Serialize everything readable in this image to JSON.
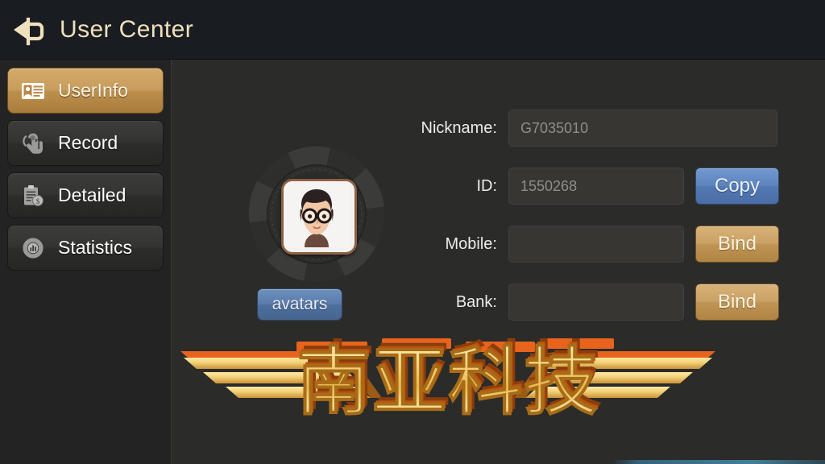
{
  "header": {
    "title": "User Center",
    "back_icon": "back-arrow-icon",
    "background_color": "#191c21",
    "title_color": "#f0e0bd"
  },
  "sidebar": {
    "background_color": "#232323",
    "active_color": "#c79c5c",
    "items": [
      {
        "id": "userinfo",
        "label": "UserInfo",
        "icon": "id-card-icon",
        "active": true
      },
      {
        "id": "record",
        "label": "Record",
        "icon": "hand-tap-icon",
        "active": false
      },
      {
        "id": "detailed",
        "label": "Detailed",
        "icon": "clipboard-money-icon",
        "active": false
      },
      {
        "id": "statistics",
        "label": "Statistics",
        "icon": "pie-chart-bars-icon",
        "active": false
      }
    ]
  },
  "main": {
    "avatar": {
      "image_alt": "cartoon-boy-with-glasses",
      "frame_border_color": "#8d6142",
      "ring_icon": "poker-chip-ring-icon",
      "button_label": "avatars",
      "button_color": "#5a7cab"
    },
    "form": {
      "rows": [
        {
          "id": "nickname",
          "label": "Nickname:",
          "value": "G7035010",
          "placeholder": "",
          "width": "wide",
          "button": null
        },
        {
          "id": "id",
          "label": "ID:",
          "value": "1550268",
          "placeholder": "",
          "width": "narrow",
          "button": {
            "label": "Copy",
            "style": "blue",
            "color": "#5f84bd"
          }
        },
        {
          "id": "mobile",
          "label": "Mobile:",
          "value": "",
          "placeholder": "",
          "width": "narrow",
          "button": {
            "label": "Bind",
            "style": "gold",
            "color": "#c9a166"
          }
        },
        {
          "id": "bank",
          "label": "Bank:",
          "value": "",
          "placeholder": "",
          "width": "narrow",
          "button": {
            "label": "Bind",
            "style": "gold",
            "color": "#c9a166"
          }
        }
      ]
    },
    "watermark": {
      "text": "南亚科技",
      "icon": "winged-gold-logo",
      "gold_color": "#f5d27a",
      "accent_color": "#e8641d"
    }
  }
}
